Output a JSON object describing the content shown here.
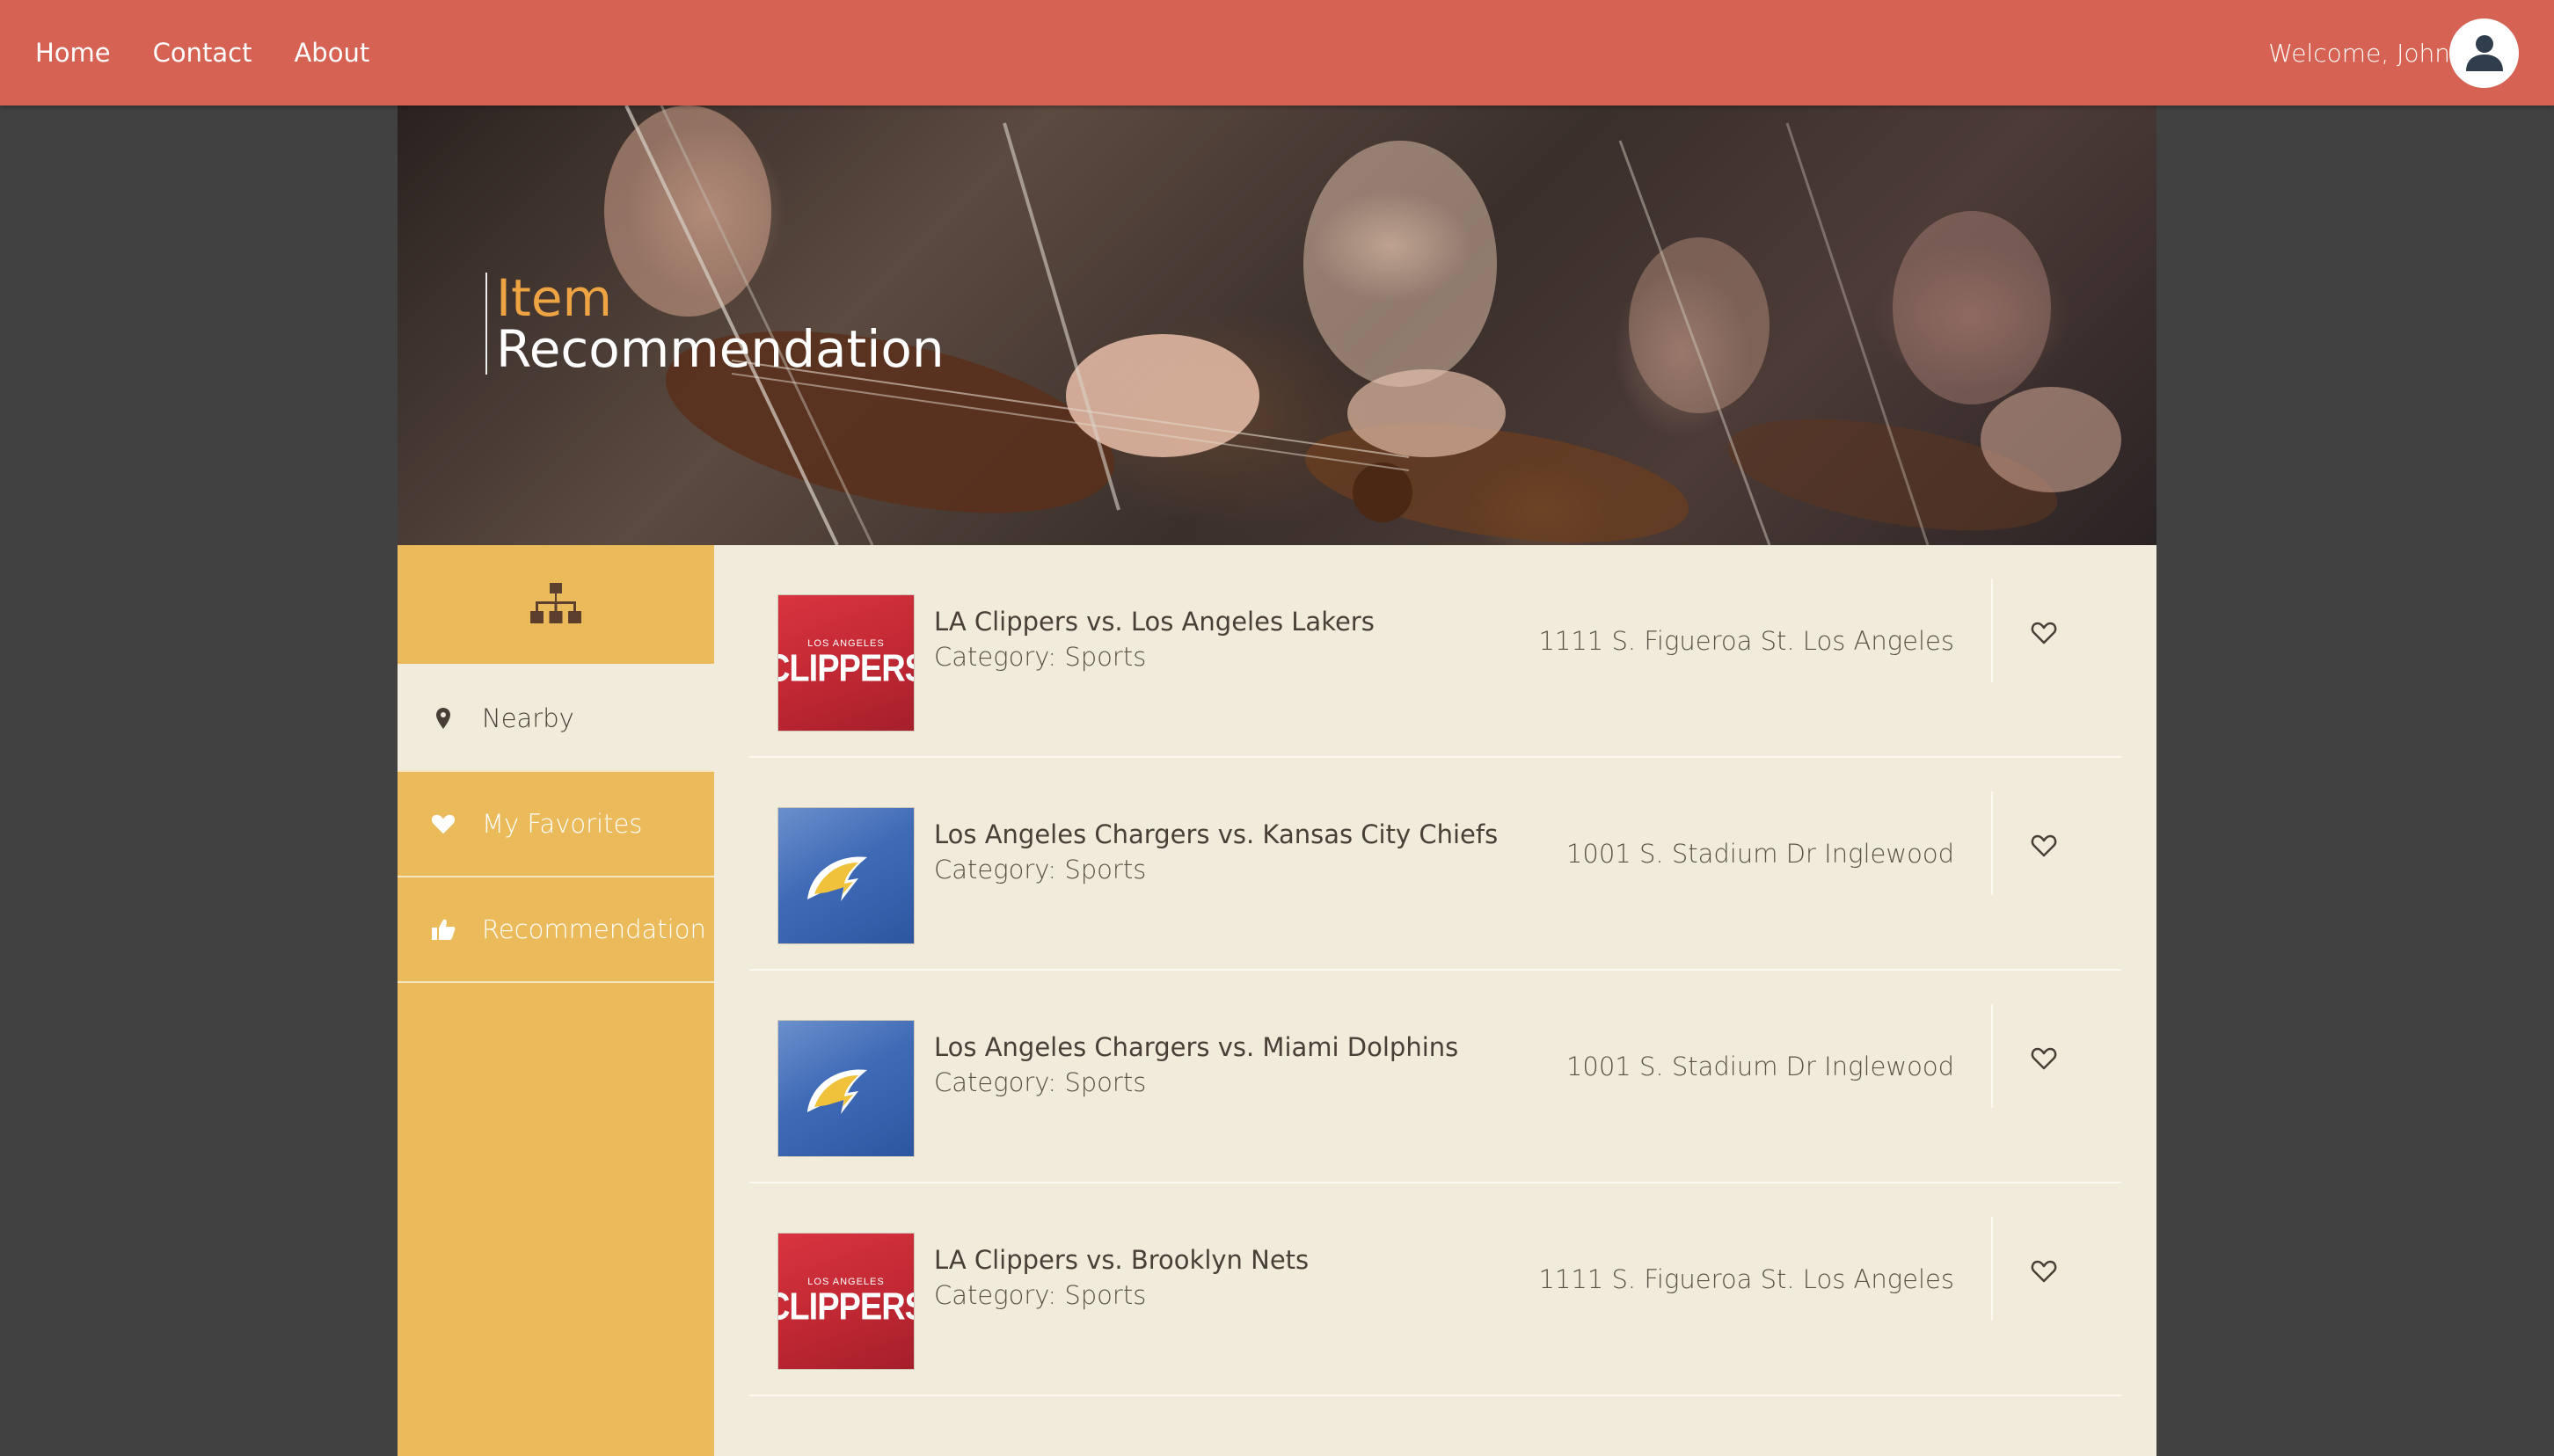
{
  "nav": {
    "links": [
      "Home",
      "Contact",
      "About"
    ],
    "welcome": "Welcome, John"
  },
  "hero": {
    "title_line1": "Item",
    "title_line2": "Recommendation"
  },
  "sidebar": {
    "items": [
      {
        "label": "Nearby",
        "icon": "map-pin-icon",
        "active": true
      },
      {
        "label": "My Favorites",
        "icon": "heart-icon",
        "active": false
      },
      {
        "label": "Recommendation",
        "icon": "thumbs-up-icon",
        "active": false
      }
    ]
  },
  "items": [
    {
      "title": "LA Clippers vs. Los Angeles Lakers",
      "category": "Category: Sports",
      "address": "1111 S. Figueroa St. Los Angeles",
      "logo": {
        "type": "clippers",
        "small": "LOS ANGELES",
        "big": "CLIPPERS"
      }
    },
    {
      "title": "Los Angeles Chargers vs. Kansas City Chiefs",
      "category": "Category: Sports",
      "address": "1001 S. Stadium Dr Inglewood",
      "logo": {
        "type": "chargers"
      }
    },
    {
      "title": "Los Angeles Chargers vs. Miami Dolphins",
      "category": "Category: Sports",
      "address": "1001 S. Stadium Dr Inglewood",
      "logo": {
        "type": "chargers"
      }
    },
    {
      "title": "LA Clippers vs. Brooklyn Nets",
      "category": "Category: Sports",
      "address": "1111 S. Figueroa St. Los Angeles",
      "logo": {
        "type": "clippers",
        "small": "LOS ANGELES",
        "big": "CLIPPERS"
      }
    }
  ],
  "colors": {
    "nav": "#d56253",
    "background": "#414141",
    "content": "#f1ebdc",
    "sidebar": "#ebbb5b",
    "accent_title": "#efa443"
  }
}
